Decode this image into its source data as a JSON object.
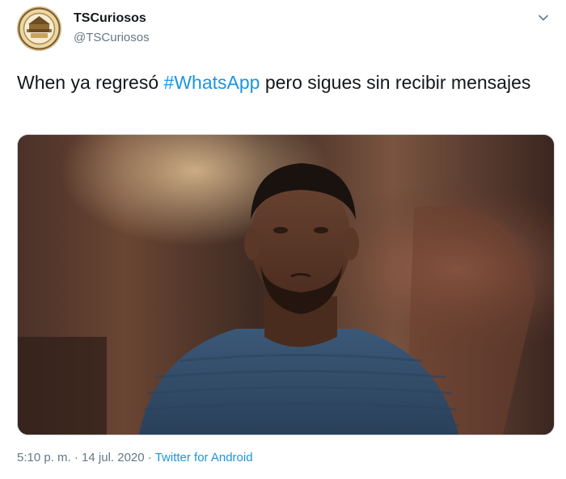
{
  "author": {
    "name": "TSCuriosos",
    "handle": "@TSCuriosos",
    "avatar_icon": "tscuriosos-logo-avatar"
  },
  "tweet": {
    "text_before": "When ya regresó ",
    "hashtag": "#WhatsApp",
    "text_after": " pero sigues sin recibir mensajes"
  },
  "media": {
    "kind": "photo"
  },
  "footer": {
    "time": "5:10 p. m.",
    "separator": " · ",
    "date": "14 jul. 2020",
    "source": "Twitter for Android"
  },
  "colors": {
    "link": "#1b95e0",
    "text": "#14171a",
    "muted": "#657786"
  },
  "icons": {
    "menu": "chevron-down-icon"
  }
}
